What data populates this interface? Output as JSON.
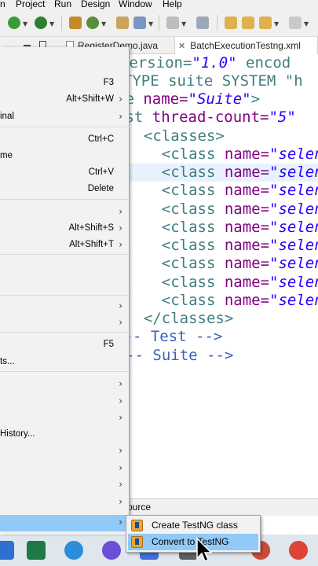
{
  "menubar": {
    "items": [
      "n",
      "Project",
      "Run",
      "Design",
      "Window",
      "Help"
    ]
  },
  "tabs": [
    {
      "label": "RegisterDemo.java",
      "active": false
    },
    {
      "label": "BatchExecutionTestng.xml",
      "active": true
    }
  ],
  "editor": {
    "lines": [
      [
        {
          "t": "l version=",
          "c": "t-tag"
        },
        {
          "t": "\"1.0\"",
          "c": "t-str"
        },
        {
          "t": " encod",
          "c": "t-tag"
        }
      ],
      [
        {
          "t": "OCTYPE suite SYSTEM \"h",
          "c": "t-tag"
        }
      ],
      [
        {
          "t": "te ",
          "c": "t-tag"
        },
        {
          "t": "name=",
          "c": "t-attr"
        },
        {
          "t": "\"Suite\"",
          "c": "t-str"
        },
        {
          "t": ">",
          "c": "t-tag"
        }
      ],
      [
        {
          "t": "est ",
          "c": "t-tag"
        },
        {
          "t": "thread-count=",
          "c": "t-attr"
        },
        {
          "t": "\"5\"",
          "c": "t-str"
        }
      ],
      [
        {
          "t": "  <classes>",
          "c": "t-tag"
        }
      ],
      [
        {
          "t": "    <class ",
          "c": "t-tag"
        },
        {
          "t": "name=",
          "c": "t-attr"
        },
        {
          "t": "\"selen",
          "c": "t-str"
        }
      ],
      [
        {
          "t": "    <class ",
          "c": "t-tag"
        },
        {
          "t": "name=",
          "c": "t-attr"
        },
        {
          "t": "\"selen",
          "c": "t-str"
        }
      ],
      [
        {
          "t": "    <class ",
          "c": "t-tag"
        },
        {
          "t": "name=",
          "c": "t-attr"
        },
        {
          "t": "\"selen",
          "c": "t-str"
        }
      ],
      [
        {
          "t": "    <class ",
          "c": "t-tag"
        },
        {
          "t": "name=",
          "c": "t-attr"
        },
        {
          "t": "\"selen",
          "c": "t-str"
        }
      ],
      [
        {
          "t": "    <class ",
          "c": "t-tag"
        },
        {
          "t": "name=",
          "c": "t-attr"
        },
        {
          "t": "\"selen",
          "c": "t-str"
        }
      ],
      [
        {
          "t": "    <class ",
          "c": "t-tag"
        },
        {
          "t": "name=",
          "c": "t-attr"
        },
        {
          "t": "\"selen",
          "c": "t-str"
        }
      ],
      [
        {
          "t": "    <class ",
          "c": "t-tag"
        },
        {
          "t": "name=",
          "c": "t-attr"
        },
        {
          "t": "\"selen",
          "c": "t-str"
        }
      ],
      [
        {
          "t": "    <class ",
          "c": "t-tag"
        },
        {
          "t": "name=",
          "c": "t-attr"
        },
        {
          "t": "\"selen",
          "c": "t-str"
        }
      ],
      [
        {
          "t": "    <class ",
          "c": "t-tag"
        },
        {
          "t": "name=",
          "c": "t-attr"
        },
        {
          "t": "\"selen",
          "c": "t-str"
        }
      ],
      [
        {
          "t": "  </classes>",
          "c": "t-tag"
        }
      ],
      [
        {
          "t": "test> ",
          "c": "t-tag"
        },
        {
          "t": "<!-- Test -->",
          "c": "t-cmt"
        }
      ],
      [
        {
          "t": "ite> ",
          "c": "t-tag"
        },
        {
          "t": "<!-- Suite -->",
          "c": "t-cmt"
        }
      ]
    ]
  },
  "bottom_tab": {
    "label": "ource"
  },
  "context_menu": {
    "items": [
      {
        "label": "",
        "shortcut": "F3",
        "arrow": false
      },
      {
        "label": "",
        "shortcut": "Alt+Shift+W",
        "arrow": true
      },
      {
        "label": "inal",
        "shortcut": "",
        "arrow": true
      },
      {
        "label": "",
        "shortcut": "Ctrl+C",
        "arrow": false
      },
      {
        "label": "me",
        "shortcut": "",
        "arrow": false
      },
      {
        "label": "",
        "shortcut": "Ctrl+V",
        "arrow": false
      },
      {
        "label": "",
        "shortcut": "Delete",
        "arrow": false
      },
      {
        "label": "",
        "shortcut": "",
        "arrow": true
      },
      {
        "label": "",
        "shortcut": "Alt+Shift+S",
        "arrow": true
      },
      {
        "label": "",
        "shortcut": "Alt+Shift+T",
        "arrow": true
      },
      {
        "label": "",
        "shortcut": "",
        "arrow": true
      },
      {
        "label": "",
        "shortcut": "",
        "arrow": true
      },
      {
        "label": "",
        "shortcut": "F5",
        "arrow": false
      },
      {
        "label": "ts...",
        "shortcut": "",
        "arrow": false
      },
      {
        "label": "",
        "shortcut": "",
        "arrow": true
      },
      {
        "label": "",
        "shortcut": "",
        "arrow": true
      },
      {
        "label": "",
        "shortcut": "",
        "arrow": true
      },
      {
        "label": " History...",
        "shortcut": "",
        "arrow": false
      },
      {
        "label": "",
        "shortcut": "",
        "arrow": true
      },
      {
        "label": "",
        "shortcut": "",
        "arrow": true
      },
      {
        "label": "",
        "shortcut": "",
        "arrow": true
      },
      {
        "label": "",
        "shortcut": "",
        "arrow": true
      }
    ]
  },
  "submenu": {
    "items": [
      {
        "label": "Create TestNG class",
        "icon": "testng-class-icon",
        "hover": false
      },
      {
        "label": "Convert to TestNG",
        "icon": "testng-convert-icon",
        "hover": true
      }
    ]
  },
  "colors": {
    "tag": "#3f7f7f",
    "attribute": "#7f007f",
    "string": "#2a00ff",
    "comment": "#3f5fbf",
    "menu_highlight": "#91c9f7"
  },
  "taskbar": {
    "icons": [
      "edge-icon",
      "excel-icon",
      "edge-browser-icon",
      "teams-icon",
      "photos-icon",
      "app-icon",
      "app-icon-2",
      "chrome-icon"
    ]
  }
}
